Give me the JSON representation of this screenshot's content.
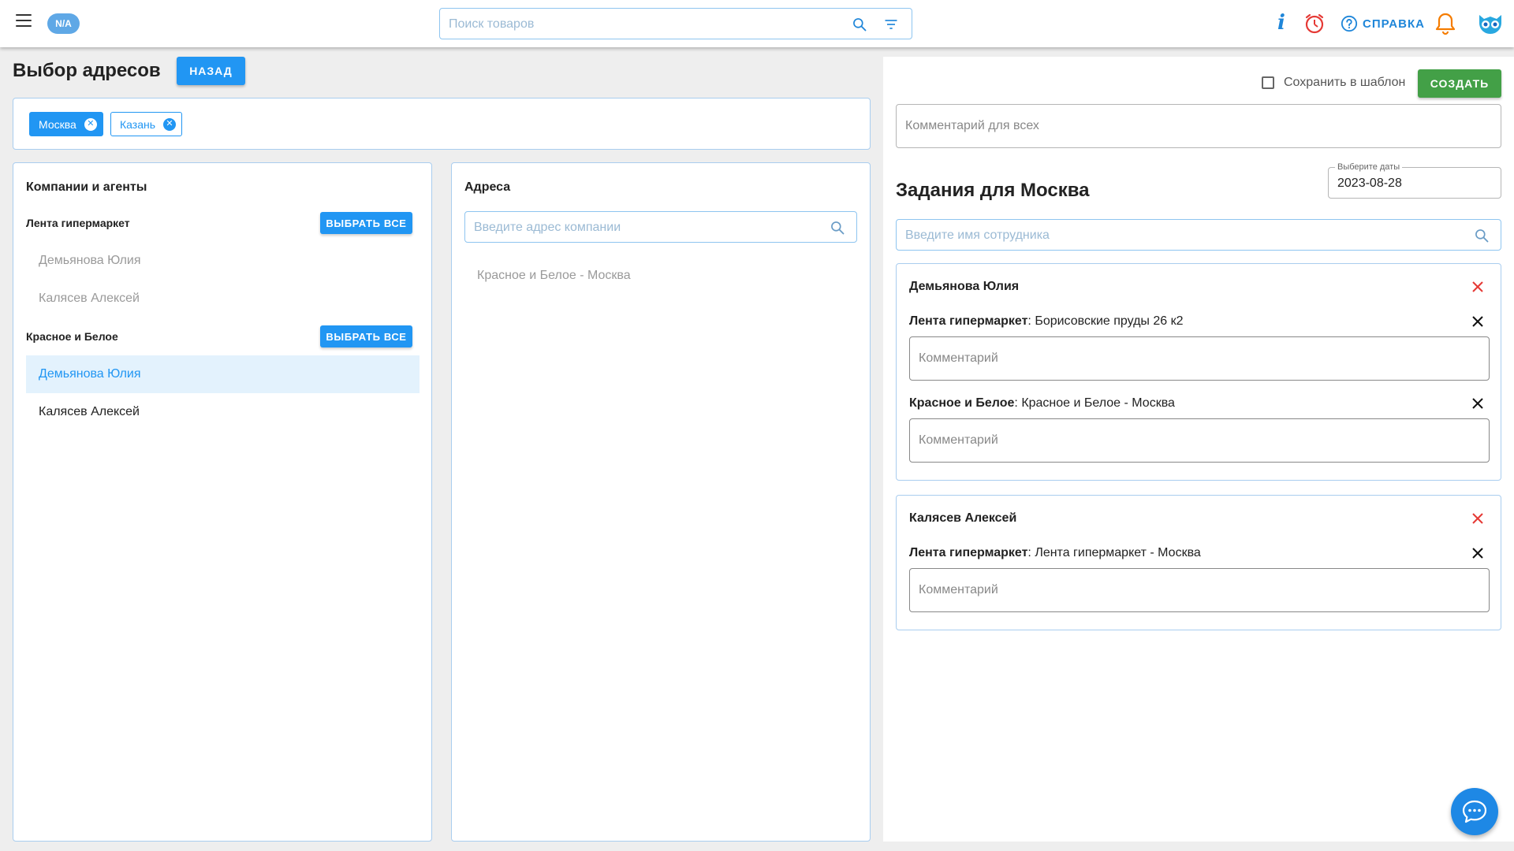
{
  "topbar": {
    "user_badge": "N/A",
    "search_placeholder": "Поиск товаров",
    "help_label": "СПРАВКА"
  },
  "header": {
    "title": "Выбор адресов",
    "back_label": "НАЗАД"
  },
  "cities": [
    {
      "label": "Москва",
      "active": true
    },
    {
      "label": "Казань",
      "active": false
    }
  ],
  "companies_panel": {
    "title": "Компании и агенты",
    "select_all_label": "ВЫБРАТЬ ВСЕ",
    "groups": [
      {
        "name": "Лента гипермаркет",
        "agents": [
          "Демьянова Юлия",
          "Калясев Алексей"
        ]
      },
      {
        "name": "Красное и Белое",
        "agents": [
          "Демьянова Юлия",
          "Калясев Алексей"
        ]
      }
    ]
  },
  "addresses_panel": {
    "title": "Адреса",
    "search_placeholder": "Введите адрес компании",
    "items": [
      "Красное и Белое - Москва"
    ]
  },
  "tasks_panel": {
    "save_template_label": "Сохранить в шаблон",
    "create_label": "СОЗДАТЬ",
    "comment_all_placeholder": "Комментарий для всех",
    "title": "Задания для Москва",
    "date_label": "Выберите даты",
    "date_value": "2023-08-28",
    "employee_search_placeholder": "Введите имя сотрудника",
    "comment_placeholder": "Комментарий",
    "employees": [
      {
        "name": "Демьянова Юлия",
        "tasks": [
          {
            "company": "Лента гипермаркет",
            "address": ": Борисовские пруды 26 к2"
          },
          {
            "company": "Красное и Белое",
            "address": ": Красное и Белое - Москва"
          }
        ]
      },
      {
        "name": "Калясев Алексей",
        "tasks": [
          {
            "company": "Лента гипермаркет",
            "address": ": Лента гипермаркет - Москва"
          }
        ]
      }
    ]
  },
  "colors": {
    "primary": "#2196f3",
    "create": "#43a047",
    "remove_employee": "#e53935",
    "notification": "#f57c00"
  },
  "icons": [
    "menu-icon",
    "search-icon",
    "filter-icon",
    "info-icon",
    "clock-icon",
    "help-icon",
    "bell-icon",
    "logo-icon",
    "close-icon",
    "chat-icon"
  ]
}
